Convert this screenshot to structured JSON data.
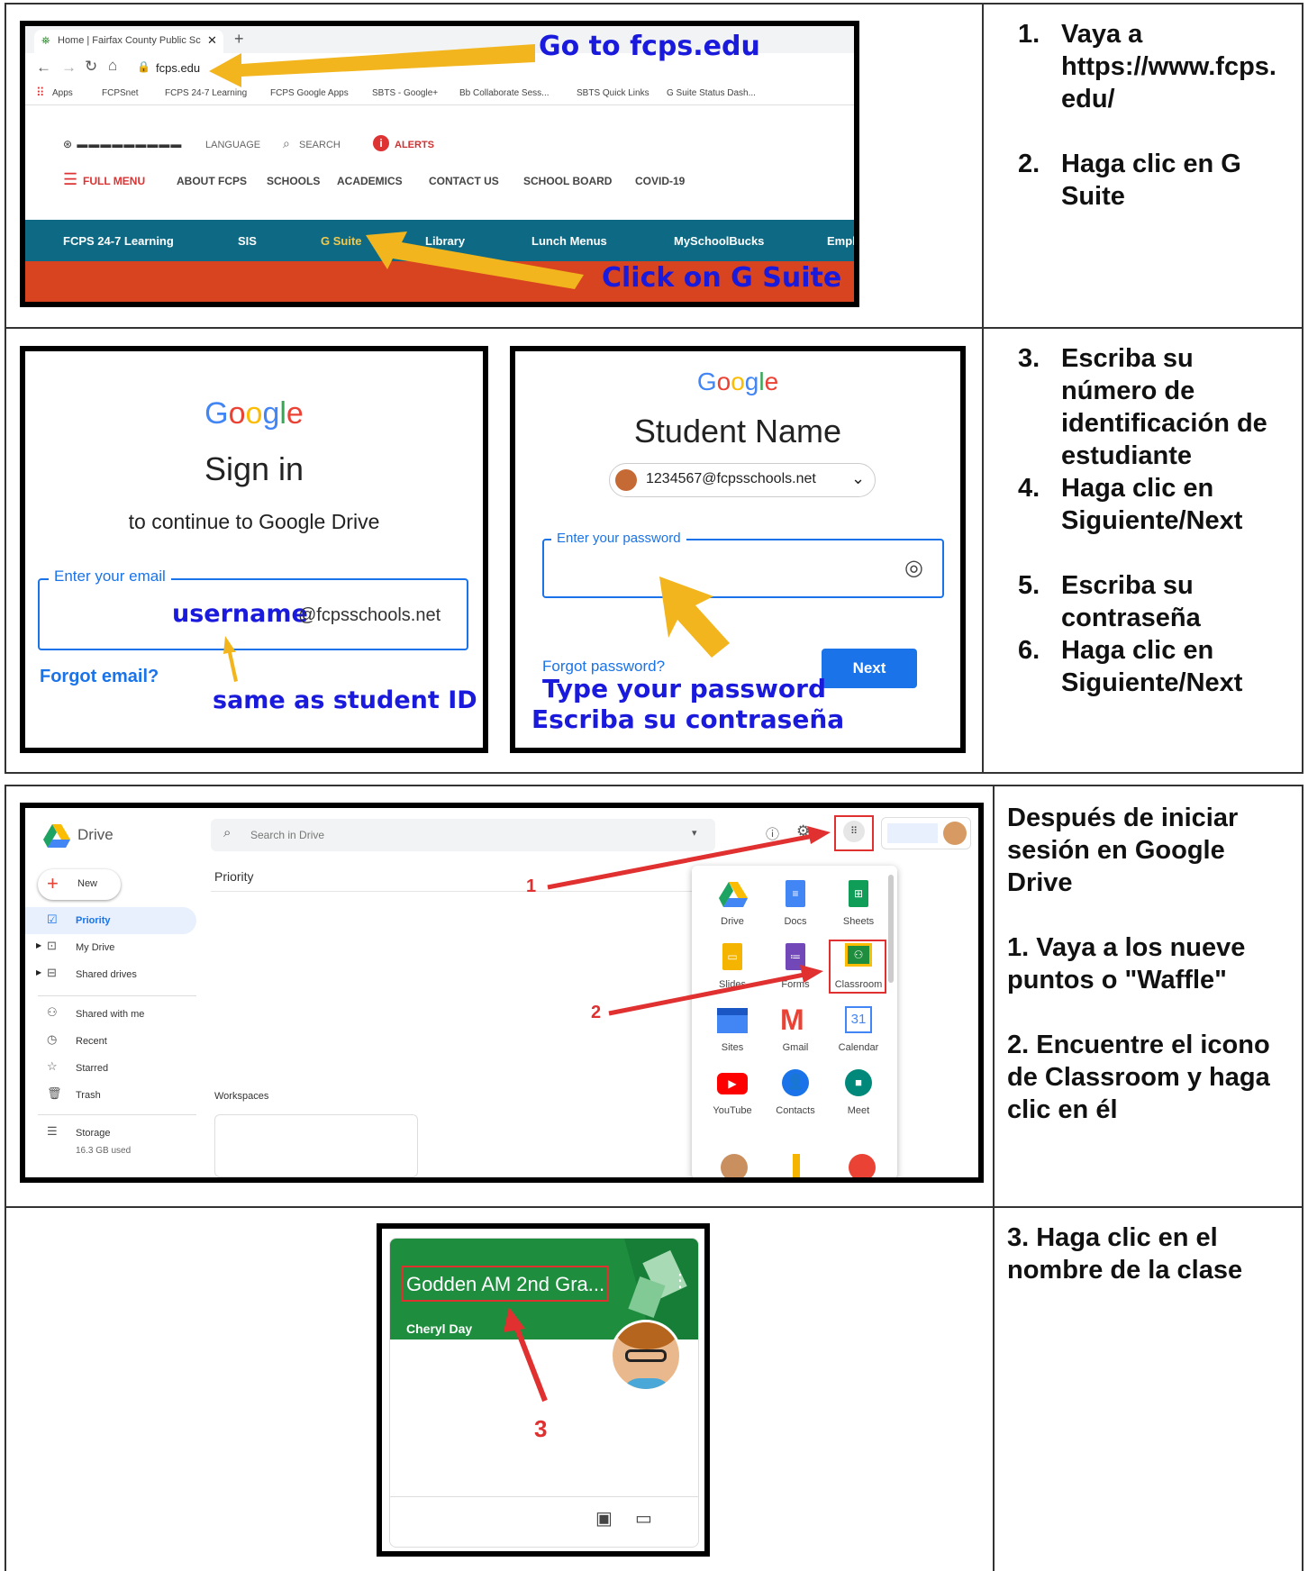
{
  "row1": {
    "browser": {
      "tab_title": "Home | Fairfax County Public Sc…",
      "url": "fcps.edu",
      "bookmarks": [
        "Apps",
        "FCPSnet",
        "FCPS 24-7 Learning",
        "FCPS Google Apps",
        "SBTS - Google+",
        "Bb Collaborate Sess...",
        "SBTS Quick Links",
        "G Suite Status Dash..."
      ],
      "top_links": {
        "language": "LANGUAGE",
        "search": "SEARCH",
        "alerts": "ALERTS"
      },
      "menu": [
        "FULL MENU",
        "ABOUT FCPS",
        "SCHOOLS",
        "ACADEMICS",
        "CONTACT US",
        "SCHOOL BOARD",
        "COVID-19"
      ],
      "bluebar": [
        "FCPS 24-7 Learning",
        "SIS",
        "G Suite",
        "Library",
        "Lunch Menus",
        "MySchoolBucks",
        "Empl"
      ],
      "annotation_top": "Go to fcps.edu",
      "annotation_bottom": "Click on G Suite"
    },
    "instructions": [
      {
        "num": "1.",
        "lines": [
          "Vaya a",
          "https://www.fcps.",
          "edu/"
        ]
      },
      {
        "num": "2.",
        "lines": [
          "Haga clic en G",
          "Suite"
        ]
      }
    ]
  },
  "row2": {
    "signin": {
      "logo": "Google",
      "title": "Sign in",
      "subtitle": "to continue to Google Drive",
      "field_label": "Enter your email",
      "username": "username",
      "domain": "@fcpsschools.net",
      "forgot": "Forgot email?",
      "note": "same as student ID"
    },
    "password": {
      "logo": "Google",
      "name": "Student Name",
      "account": "1234567@fcpsschools.net",
      "field_label": "Enter your password",
      "forgot": "Forgot password?",
      "next": "Next",
      "note_en": "Type your password",
      "note_es": "Escriba su contraseña"
    },
    "instructions": [
      {
        "num": "3.",
        "lines": [
          "Escriba su",
          "número de",
          "identificación de",
          "estudiante"
        ]
      },
      {
        "num": "4.",
        "lines": [
          "Haga clic en",
          "Siguiente/Next"
        ]
      },
      {
        "num": "5.",
        "lines": [
          "Escriba su",
          "contraseña"
        ]
      },
      {
        "num": "6.",
        "lines": [
          "Haga clic en",
          "Siguiente/Next"
        ]
      }
    ]
  },
  "row3": {
    "drive": {
      "app_name": "Drive",
      "search_placeholder": "Search in Drive",
      "new_label": "New",
      "priority_heading": "Priority",
      "workspaces": "Workspaces",
      "sidebar": [
        "Priority",
        "My Drive",
        "Shared drives",
        "Shared with me",
        "Recent",
        "Starred",
        "Trash",
        "Storage"
      ],
      "storage_used": "16.3 GB used",
      "apps": [
        "Drive",
        "Docs",
        "Sheets",
        "Slides",
        "Forms",
        "Classroom",
        "Sites",
        "Gmail",
        "Calendar",
        "YouTube",
        "Contacts",
        "Meet"
      ],
      "calendar_day": "31",
      "marker1": "1",
      "marker2": "2"
    },
    "instructions": [
      "Después de iniciar",
      "sesión en Google",
      "Drive",
      "",
      "1. Vaya a los nueve",
      "puntos o \"Waffle\"",
      "",
      "2. Encuentre el icono",
      "de Classroom y haga",
      "clic en él"
    ]
  },
  "row4": {
    "card": {
      "class_name": "Godden AM 2nd Gra...",
      "teacher": "Cheryl Day",
      "marker": "3"
    },
    "instructions": [
      "3. Haga clic en el",
      "nombre de la clase"
    ]
  },
  "colors": {
    "google_blue": "#1a73e8",
    "annotation_blue": "#1a1adc",
    "arrow_yellow": "#f2b51d",
    "arrow_red": "#e03030",
    "classroom_green": "#1e8e3e"
  }
}
